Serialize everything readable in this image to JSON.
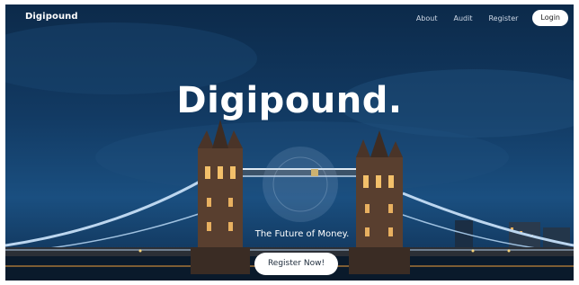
{
  "nav": {
    "brand": "Digipound",
    "links": [
      "About",
      "Audit",
      "Register"
    ],
    "login_label": "Login"
  },
  "hero": {
    "headline": "Digipound.",
    "tagline": "The Future of Money.",
    "cta_label": "Register Now!"
  }
}
